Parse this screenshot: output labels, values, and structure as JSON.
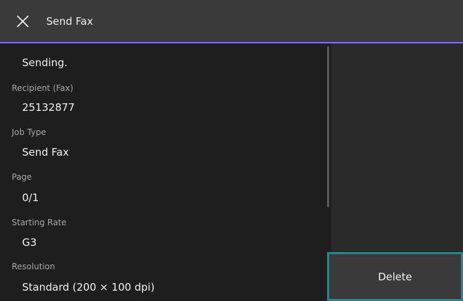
{
  "header": {
    "title": "Send Fax",
    "close_icon": "close-icon",
    "accent_color": "#8a6ff0"
  },
  "status": "Sending.",
  "fields": {
    "recipient": {
      "label": "Recipient (Fax)",
      "value": "25132877"
    },
    "job_type": {
      "label": "Job Type",
      "value": "Send Fax"
    },
    "page": {
      "label": "Page",
      "value": "0/1"
    },
    "starting_rate": {
      "label": "Starting Rate",
      "value": "G3"
    },
    "resolution": {
      "label": "Resolution",
      "value": "Standard (200 × 100 dpi)"
    }
  },
  "actions": {
    "delete_label": "Delete",
    "focus_color": "#1d8a90"
  }
}
